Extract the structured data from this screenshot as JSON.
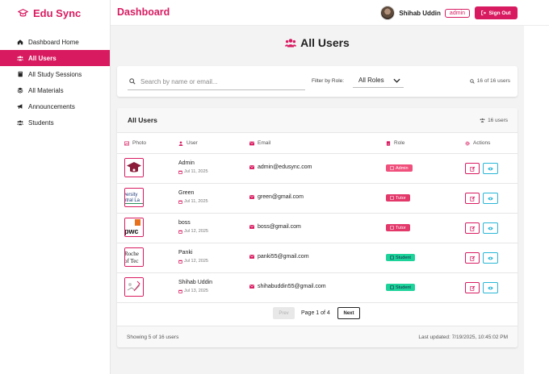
{
  "brand": {
    "name": "Edu Sync"
  },
  "sidebar": {
    "items": [
      {
        "label": "Dashboard Home",
        "icon": "home-icon"
      },
      {
        "label": "All Users",
        "icon": "users-icon",
        "active": true
      },
      {
        "label": "All Study Sessions",
        "icon": "book-icon"
      },
      {
        "label": "All Materials",
        "icon": "layers-icon"
      },
      {
        "label": "Announcements",
        "icon": "megaphone-icon"
      },
      {
        "label": "Students",
        "icon": "users-icon"
      }
    ]
  },
  "header": {
    "title": "Dashboard",
    "user_name": "Shihab Uddin",
    "user_role": "admin",
    "signout_label": "Sign Out"
  },
  "main": {
    "heading": "All Users",
    "search": {
      "placeholder": "Search by name or email...",
      "value": ""
    },
    "filter_label": "Filter by Role:",
    "role_selected": "All Roles",
    "count_top": "16 of 16 users",
    "table_title": "All Users",
    "table_count": "16 users",
    "columns": [
      "Photo",
      "User",
      "Email",
      "Role",
      "Actions"
    ],
    "rows": [
      {
        "name": "Admin",
        "date": "Jul 11, 2025",
        "email": "admin@edusync.com",
        "role": "Admin",
        "role_color": "#f0507c"
      },
      {
        "name": "Green",
        "date": "Jul 11, 2025",
        "email": "green@gmail.com",
        "role": "Tutor",
        "role_color": "#e2386a"
      },
      {
        "name": "boss",
        "date": "Jul 12, 2025",
        "email": "boss@gmail.com",
        "role": "Tutor",
        "role_color": "#e2386a"
      },
      {
        "name": "Panki",
        "date": "Jul 12, 2025",
        "email": "panki55@gmail.com",
        "role": "Student",
        "role_color": "#1ed39a"
      },
      {
        "name": "Shihab Uddin",
        "date": "Jul 13, 2025",
        "email": "shihabuddin55@gmail.com",
        "role": "Student",
        "role_color": "#1ed39a"
      }
    ],
    "pager": {
      "prev": "Prev",
      "label": "Page 1 of 4",
      "next": "Next"
    },
    "footer_left": "Showing 5 of 16 users",
    "footer_right": "Last updated: 7/19/2025, 10:45:02 PM"
  },
  "colors": {
    "accent": "#d81b60",
    "info": "#29b6d6"
  }
}
